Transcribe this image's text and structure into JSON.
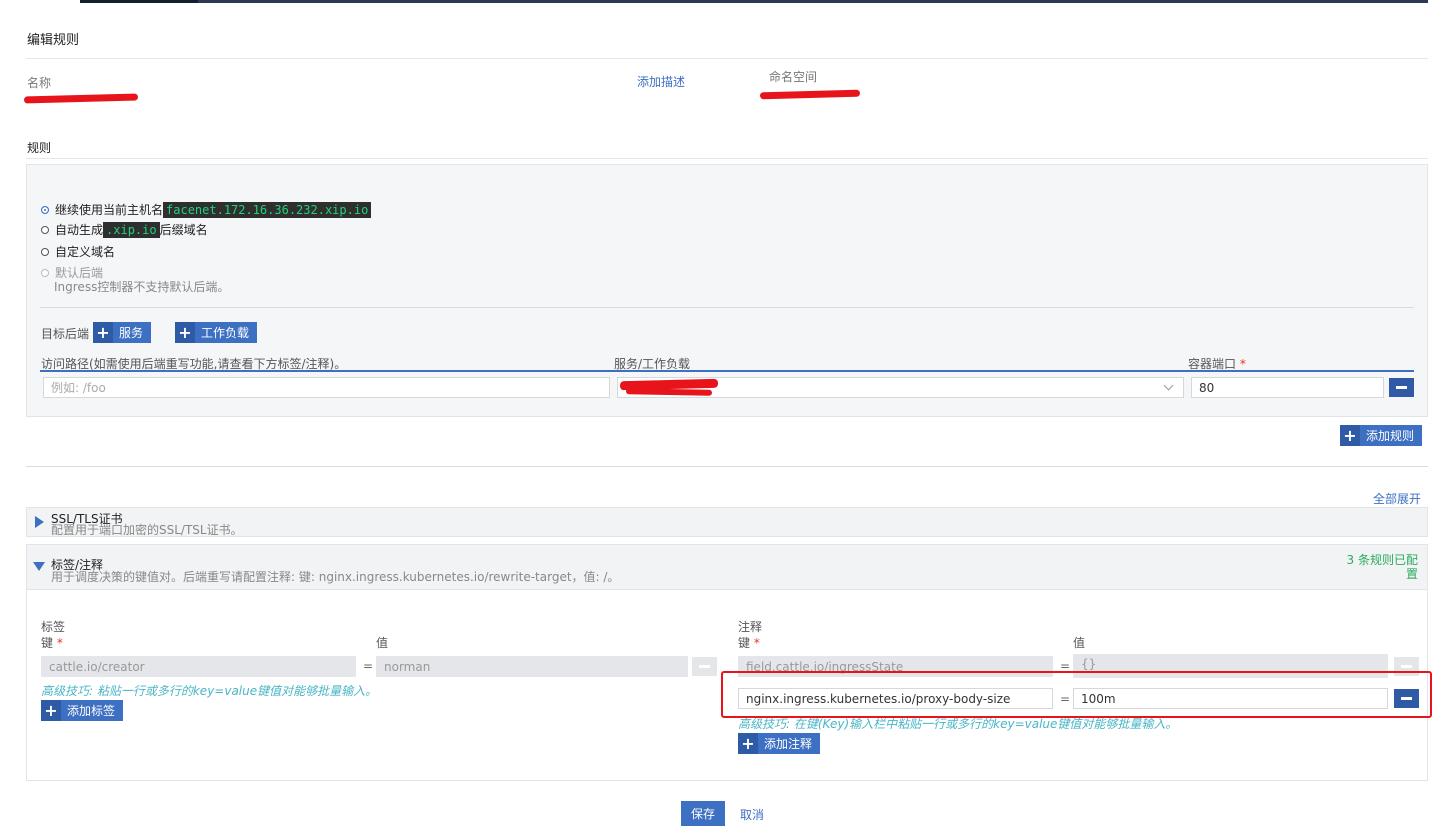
{
  "page": {
    "title": "编辑规则"
  },
  "header": {
    "name_label": "名称",
    "add_description": "添加描述",
    "namespace_label": "命名空间"
  },
  "rules": {
    "section_title": "规则",
    "hostname_options": [
      {
        "label": "继续使用当前主机名",
        "code": "facenet.172.16.36.232.xip.io",
        "selected": true
      },
      {
        "label_pre": "自动生成",
        "code": ".xip.io",
        "label_post": "后缀域名",
        "selected": false
      },
      {
        "label": "自定义域名",
        "selected": false
      },
      {
        "label": "默认后端",
        "note": "Ingress控制器不支持默认后端。",
        "disabled": true
      }
    ],
    "target_backend_label": "目标后端",
    "add_service": "服务",
    "add_workload": "工作负载",
    "columns": {
      "path": "访问路径(如需使用后端重写功能,请查看下方标签/注释)。",
      "service": "服务/工作负载",
      "port": "容器端口"
    },
    "row": {
      "path_placeholder": "例如: /foo",
      "port_value": "80"
    },
    "add_rule": "添加规则"
  },
  "expand_all": "全部展开",
  "ssl": {
    "title": "SSL/TLS证书",
    "description": "配置用于端口加密的SSL/TSL证书。"
  },
  "labels_annotations": {
    "title": "标签/注释",
    "description": "用于调度决策的键值对。后端重写请配置注释: 键: nginx.ingress.kubernetes.io/rewrite-target，值: /。",
    "status": "3 条规则已配置",
    "labels": {
      "title": "标签",
      "key_header": "键",
      "value_header": "值",
      "rows": [
        {
          "key": "cattle.io/creator",
          "value": "norman"
        }
      ],
      "hint": "高级技巧: 粘贴一行或多行的key=value键值对能够批量输入。",
      "add_button": "添加标签"
    },
    "annotations": {
      "title": "注释",
      "key_header": "键",
      "value_header": "值",
      "rows": [
        {
          "key": "field.cattle.io/ingressState",
          "value": "{}"
        },
        {
          "key": "nginx.ingress.kubernetes.io/proxy-body-size",
          "value": "100m"
        }
      ],
      "hint": "高级技巧: 在键(Key)输入栏中粘贴一行或多行的key=value键值对能够批量输入。",
      "add_button": "添加注释"
    }
  },
  "footer": {
    "save": "保存",
    "cancel": "取消"
  },
  "colors": {
    "accent": "#3d6fc2",
    "annotation_highlight": "#e8141c",
    "success": "#2bab5f"
  }
}
